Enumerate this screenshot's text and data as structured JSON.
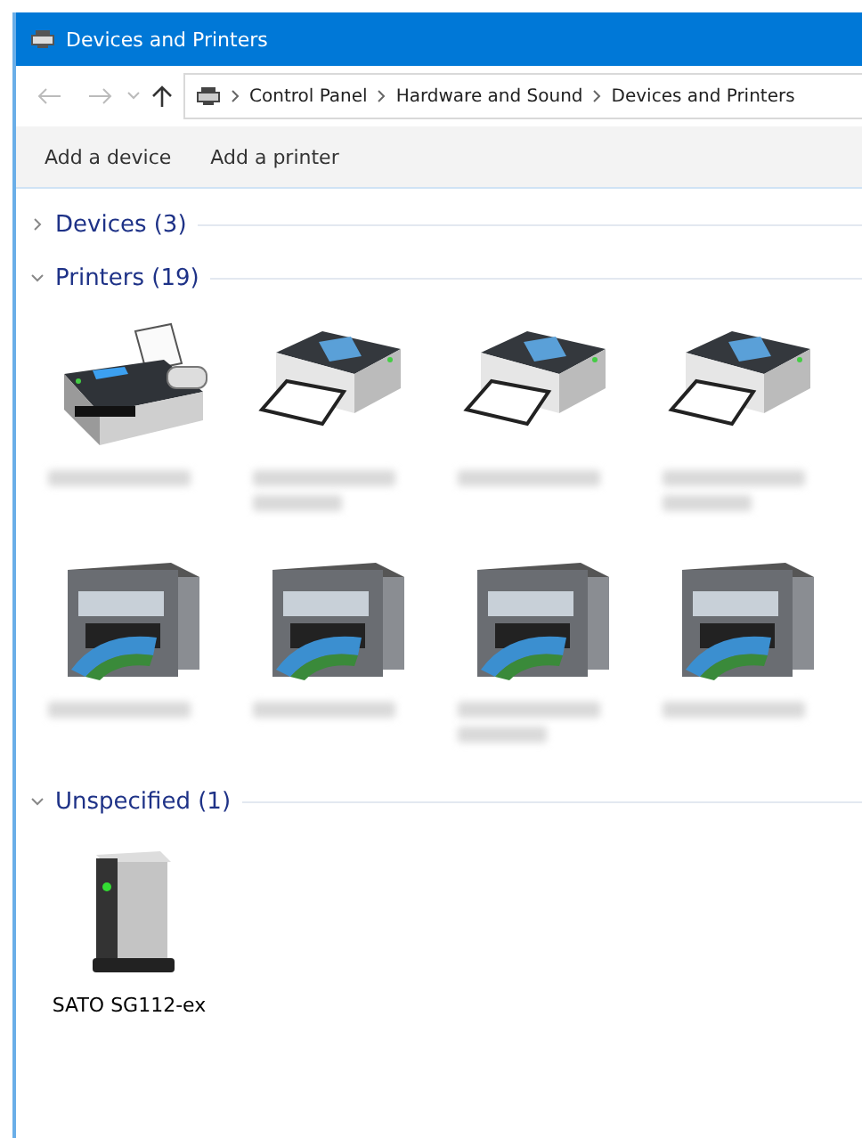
{
  "window": {
    "title": "Devices and Printers"
  },
  "address_bar": {
    "path": [
      "Control Panel",
      "Hardware and Sound",
      "Devices and Printers"
    ]
  },
  "toolbar": {
    "buttons": [
      "Add a device",
      "Add a printer"
    ]
  },
  "groups": [
    {
      "title": "Devices (3)",
      "expanded": false
    },
    {
      "title": "Printers (19)",
      "expanded": true,
      "items": [
        {
          "kind": "fax",
          "label_redacted": true,
          "label_wraps": false
        },
        {
          "kind": "printer",
          "label_redacted": true,
          "label_wraps": true
        },
        {
          "kind": "printer",
          "label_redacted": true,
          "label_wraps": false
        },
        {
          "kind": "printer",
          "label_redacted": true,
          "label_wraps": true
        },
        {
          "kind": "mfp",
          "label_redacted": true,
          "label_wraps": false
        },
        {
          "kind": "mfp",
          "label_redacted": true,
          "label_wraps": false
        },
        {
          "kind": "mfp",
          "label_redacted": true,
          "label_wraps": true
        },
        {
          "kind": "mfp",
          "label_redacted": true,
          "label_wraps": false
        }
      ]
    },
    {
      "title": "Unspecified (1)",
      "expanded": true,
      "items": [
        {
          "kind": "device",
          "label": "SATO SG112-ex"
        }
      ]
    }
  ]
}
